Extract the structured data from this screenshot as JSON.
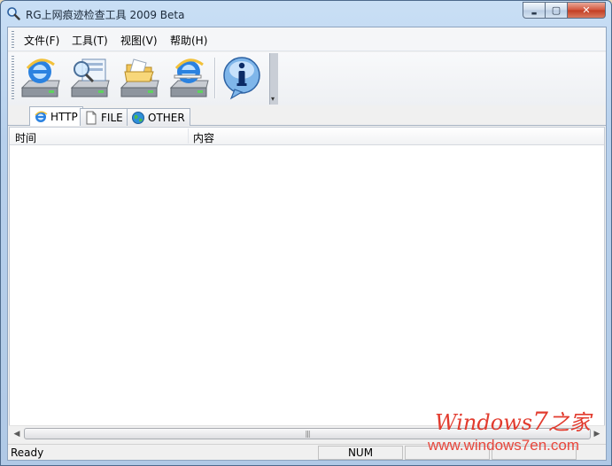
{
  "window": {
    "title": "RG上网痕迹检查工具 2009 Beta",
    "controls": {
      "minimize": "▬",
      "maximize": "▢",
      "close": "✕"
    }
  },
  "menu": [
    {
      "label": "文件(F)"
    },
    {
      "label": "工具(T)"
    },
    {
      "label": "视图(V)"
    },
    {
      "label": "帮助(H)"
    }
  ],
  "toolbar": {
    "buttons": [
      {
        "icon": "ie-drive-icon"
      },
      {
        "icon": "search-drive-icon"
      },
      {
        "icon": "folder-drive-icon"
      },
      {
        "icon": "ie-cleanup-drive-icon"
      },
      {
        "icon": "info-icon"
      }
    ],
    "overflow_glyph": "▾"
  },
  "tabs": [
    {
      "label": "HTTP",
      "icon": "ie-icon",
      "active": true
    },
    {
      "label": "FILE",
      "icon": "file-icon",
      "active": false
    },
    {
      "label": "OTHER",
      "icon": "globe-icon",
      "active": false
    }
  ],
  "listview": {
    "columns": [
      {
        "label": "时间"
      },
      {
        "label": "内容"
      }
    ],
    "rows": []
  },
  "scrollbar": {
    "left_arrow": "◀",
    "right_arrow": "▶",
    "grip": "|||"
  },
  "status": {
    "text": "Ready",
    "num": "NUM"
  },
  "watermark": {
    "line1_prefix": "Windows",
    "line1_seven": "7",
    "line1_suffix": "之家",
    "line2": "www.windows7en.com"
  },
  "colors": {
    "accent": "#1e6fd0",
    "watermark_red": "#e23b2e"
  }
}
